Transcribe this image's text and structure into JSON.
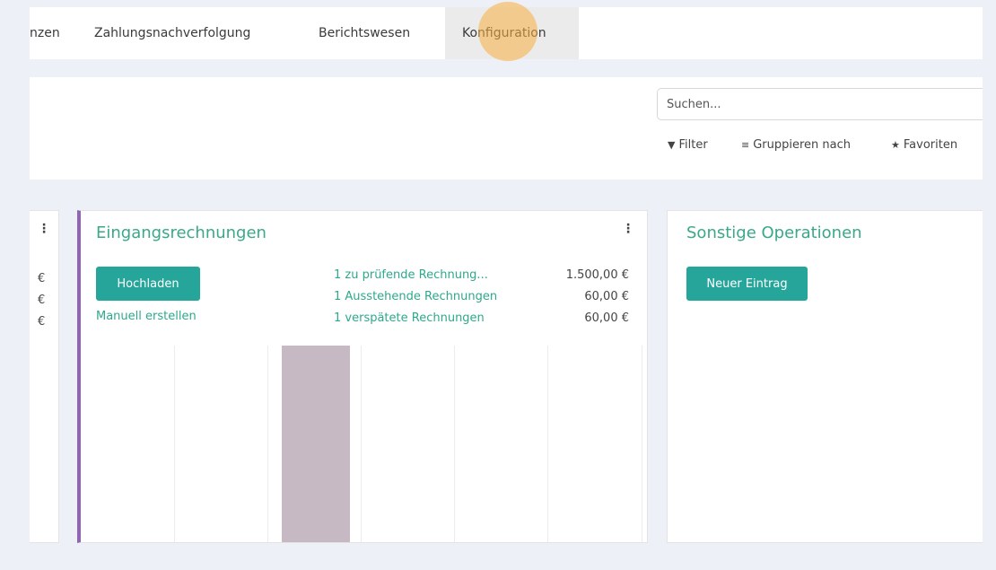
{
  "nav": {
    "items": [
      {
        "label": "nzen",
        "active": false
      },
      {
        "label": "Zahlungsnachverfolgung",
        "active": false
      },
      {
        "label": "Berichtswesen",
        "active": false
      },
      {
        "label": "Konfiguration",
        "active": true
      }
    ]
  },
  "search": {
    "placeholder": "Suchen..."
  },
  "filters": {
    "filter_label": "Filter",
    "group_label": "Gruppieren nach",
    "favorites_label": "Favoriten"
  },
  "left_card": {
    "kebab": "⋮",
    "values": [
      "€",
      "€",
      "€"
    ]
  },
  "purchase_card": {
    "title": "Eingangsrechnungen",
    "kebab": "⋮",
    "upload_label": "Hochladen",
    "manual_label": "Manuell erstellen",
    "stats": [
      {
        "label": "1 zu prüfende Rechnung...",
        "amount": "1.500,00 €"
      },
      {
        "label": "1 Ausstehende Rechnungen",
        "amount": "60,00 €"
      },
      {
        "label": "1 verspätete Rechnungen",
        "amount": "60,00 €"
      }
    ]
  },
  "misc_card": {
    "title": "Sonstige Operationen",
    "new_entry_label": "Neuer Eintrag"
  },
  "colors": {
    "accent": "#26a69a",
    "title": "#3aa889",
    "card_border_purple": "#8f67b1",
    "bar": "#c7b9c3"
  }
}
